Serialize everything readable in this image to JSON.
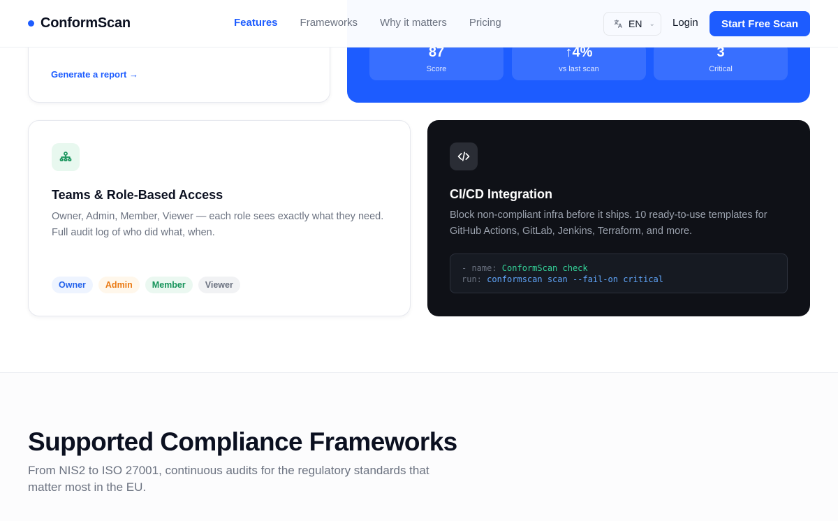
{
  "header": {
    "brand": "ConformScan",
    "nav": [
      {
        "label": "Features",
        "active": true
      },
      {
        "label": "Frameworks",
        "active": false
      },
      {
        "label": "Why it matters",
        "active": false
      },
      {
        "label": "Pricing",
        "active": false
      }
    ],
    "language": "EN",
    "login_label": "Login",
    "cta_label": "Start Free Scan"
  },
  "report_card": {
    "link_label": "Generate a report →"
  },
  "stats_card": {
    "stats": [
      {
        "value": "87",
        "label": "Score"
      },
      {
        "value": "↑4%",
        "label": "vs last scan"
      },
      {
        "value": "3",
        "label": "Critical"
      }
    ]
  },
  "teams_card": {
    "icon": "org-chart-icon",
    "title": "Teams & Role-Based Access",
    "description": "Owner, Admin, Member, Viewer — each role sees exactly what they need. Full audit log of who did what, when.",
    "roles": [
      "Owner",
      "Admin",
      "Member",
      "Viewer"
    ]
  },
  "ci_card": {
    "icon": "code-icon",
    "title": "CI/CD Integration",
    "description": "Block non-compliant infra before it ships. 10 ready-to-use templates for GitHub Actions, GitLab, Jenkins, Terraform, and more.",
    "code": {
      "line1_key": "- name: ",
      "line1_value": "ConformScan check",
      "line2_key": "run: ",
      "line2_value": "conformscan scan --fail-on critical"
    }
  },
  "frameworks_section": {
    "title": "Supported Compliance Frameworks",
    "subtitle": "From NIS2 to ISO 27001, continuous audits for the regulatory standards that matter most in the EU."
  },
  "colors": {
    "accent": "#1d5cff",
    "dark_card": "#0f1117",
    "role_owner": "#2563eb",
    "role_admin": "#ea7a14",
    "role_member": "#15935a",
    "role_viewer": "#6b7280"
  }
}
